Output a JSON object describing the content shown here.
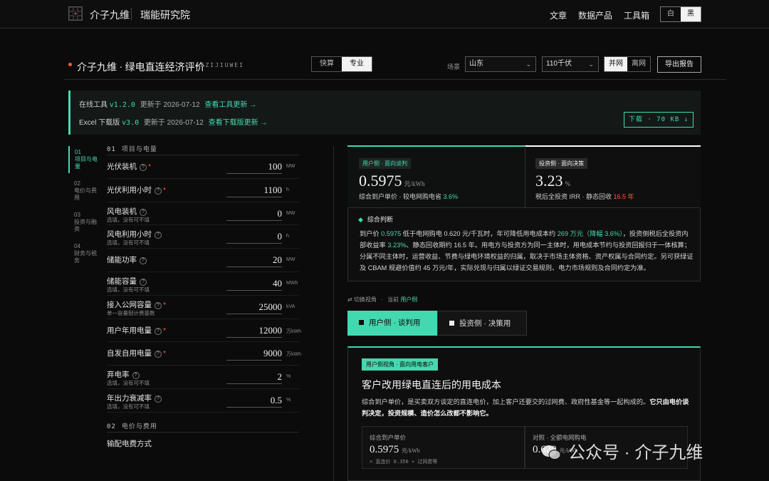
{
  "nav": {
    "brand": "介子九维",
    "sub": "瑞能研究院",
    "links": [
      "文章",
      "数据产品",
      "工具箱"
    ],
    "theme": {
      "light": "白",
      "dark": "黑"
    }
  },
  "header": {
    "title": "介子九维 · 绿电直连经济评价",
    "latin": "JIEZIJIUWEI",
    "mode": {
      "fast": "快算",
      "pro": "专业"
    },
    "scene_label": "场景",
    "region": "山东",
    "voltage": "110千伏",
    "grid": {
      "on": "并网",
      "off": "离网"
    },
    "export": "导出报告"
  },
  "banner": {
    "online_label": "在线工具",
    "online_ver": "v1.2.0",
    "online_date": "更新于 2026-07-12",
    "online_link": "查看工具更新 →",
    "excel_label": "Excel 下载版",
    "excel_ver": "v3.0",
    "excel_date": "更新于 2026-07-12",
    "excel_link": "查看下载版更新 →",
    "download": "下载 · 70 KB ↓"
  },
  "steps": [
    {
      "num": "01",
      "label": "项目与电量"
    },
    {
      "num": "02",
      "label": "电价与费用"
    },
    {
      "num": "03",
      "label": "投资与融资"
    },
    {
      "num": "04",
      "label": "财务与税务"
    }
  ],
  "form": {
    "section1": {
      "num": "01",
      "title": "项目与电量"
    },
    "rows": [
      {
        "label": "光伏装机",
        "sub": "",
        "value": "100",
        "unit": "MW",
        "required": "*"
      },
      {
        "label": "光伏利用小时",
        "sub": "",
        "value": "1100",
        "unit": "h",
        "required": "*"
      },
      {
        "label": "风电装机",
        "sub": "选填，没有可不填",
        "value": "0",
        "unit": "MW",
        "required": ""
      },
      {
        "label": "风电利用小时",
        "sub": "选填，没有可不填",
        "value": "0",
        "unit": "h",
        "required": ""
      },
      {
        "label": "储能功率",
        "sub": "",
        "value": "20",
        "unit": "MW",
        "required": ""
      },
      {
        "label": "储能容量",
        "sub": "选填，没有可不填",
        "value": "40",
        "unit": "MWh",
        "required": ""
      },
      {
        "label": "接入公网容量",
        "sub": "单一容量制计费基数",
        "value": "25000",
        "unit": "kVA",
        "required": "*"
      },
      {
        "label": "用户年用电量",
        "sub": "",
        "value": "12000",
        "unit": "万kWh",
        "required": "*"
      },
      {
        "label": "自发自用电量",
        "sub": "",
        "value": "9000",
        "unit": "万kWh",
        "required": "*"
      },
      {
        "label": "弃电率",
        "sub": "选填，没有可不填",
        "value": "2",
        "unit": "%",
        "required": ""
      },
      {
        "label": "年出力衰减率",
        "sub": "选填，没有可不填",
        "value": "0.5",
        "unit": "%",
        "required": ""
      }
    ],
    "section2": {
      "num": "02",
      "title": "电价与费用"
    },
    "cut_row": "输配电费方式"
  },
  "cards": {
    "user": {
      "badge": "用户侧 · 面向谈判",
      "value": "0.5975",
      "unit": "元/kWh",
      "note_a": "综合到户单价 · 较电网购电省",
      "note_b": "3.6%"
    },
    "invest": {
      "badge": "投资侧 · 面向决策",
      "value": "3.23",
      "unit": "%",
      "note_a": "税后全投资 IRR · 静态回收",
      "note_b": "16.5 年"
    }
  },
  "summary": {
    "title": "综合判断",
    "t1": "到户价 ",
    "h1": "0.5975",
    "t2": " 低于电网购电 0.620 元/千瓦时，年可降低用电成本约 ",
    "h2": "269 万元（降幅 3.6%）",
    "t3": "，投资侧税后全投资内部收益率 ",
    "h3": "3.23%",
    "t4": "、静态回收期约 16.5 年。用电方与投资方为同一主体时，用电成本节约与投资回报归于一体核算；分属不同主体时，运营收益、节费与绿电环境权益的归属，取决于市场主体资格、资产权属与合同约定。另可获绿证及 CBAM 规避价值约 45 万元/年，实际兑现与归属以绿证交易规则、电力市场规则及合同约定为准。"
  },
  "switch": {
    "label": "切换视角",
    "current_label": "当前",
    "current": "用户侧",
    "tab_user": "用户侧 · 谈判用",
    "tab_invest": "投资侧 · 决策用"
  },
  "detail": {
    "badge": "用户侧视角 · 面向用电客户",
    "title": "客户改用绿电直连后的用电成本",
    "text_a": "综合到户单价，是买卖双方谈定的直连电价，加上客户还要交的过网费、政府性基金等一起构成的。",
    "text_b": "它只由电价谈判决定，投资规模、造价怎么改都不影响它。",
    "mini1": {
      "label": "综合到户单价",
      "value": "0.5975",
      "unit": "元/kWh",
      "sub": "= 直连价 0.350 + 过网费等"
    },
    "mini2": {
      "label": "对照 · 全额电网购电",
      "value": "0.620",
      "unit": "元/kWh",
      "sub": ""
    }
  },
  "watermark": "公众号 · 介子九维",
  "colors": {
    "accent": "#43d9b0",
    "alert": "#ff5a36",
    "bg": "#0b0b0b"
  }
}
